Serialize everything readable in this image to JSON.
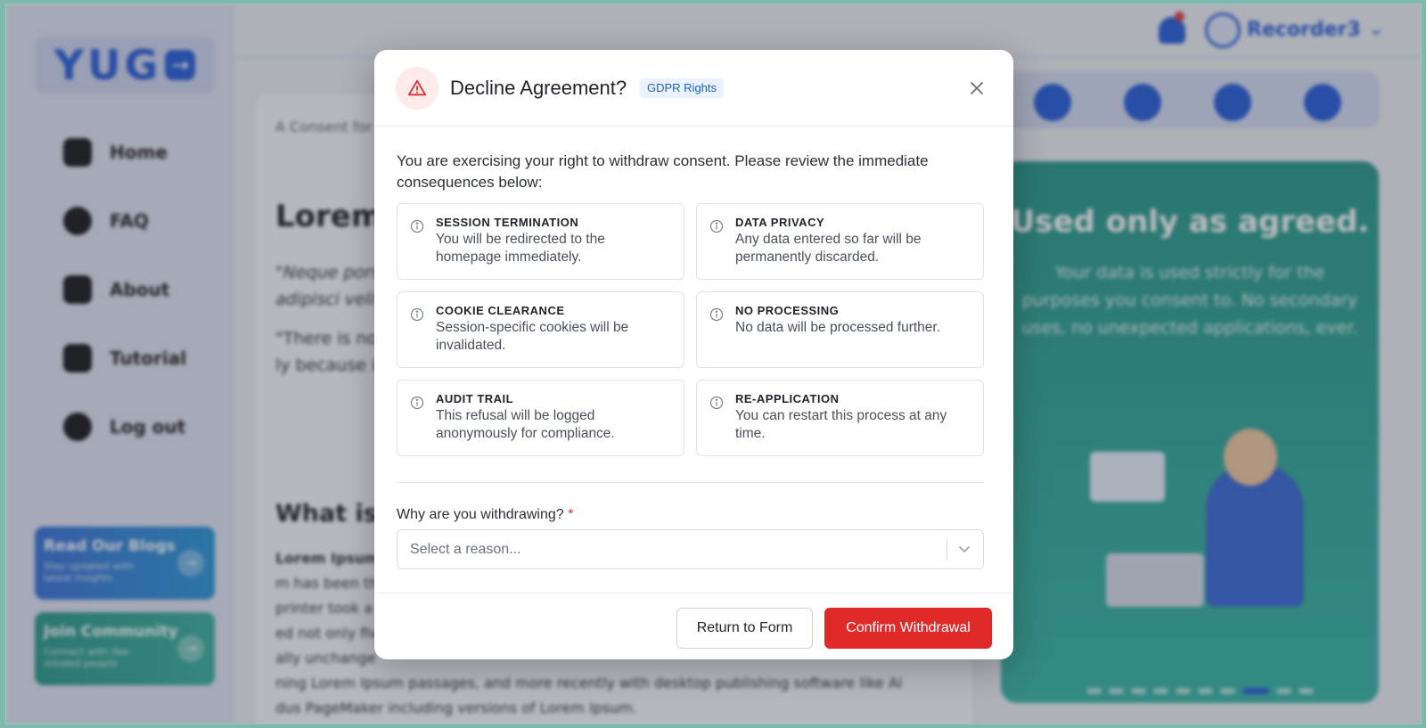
{
  "app": {
    "logo_text": "YUG",
    "username": "Recorder3"
  },
  "sidebar": {
    "items": [
      {
        "label": "Home",
        "icon": "home-icon"
      },
      {
        "label": "FAQ",
        "icon": "question-icon"
      },
      {
        "label": "About",
        "icon": "document-icon"
      },
      {
        "label": "Tutorial",
        "icon": "video-icon"
      },
      {
        "label": "Log out",
        "icon": "logout-icon"
      }
    ],
    "promos": [
      {
        "title": "Read Our Blogs",
        "subtitle": "Stay updated with latest insights"
      },
      {
        "title": "Join Community",
        "subtitle": "Connect with like-minded people"
      }
    ]
  },
  "document": {
    "breadcrumb": "A Consent for",
    "heading": "Lorem I",
    "quote_line1": "\"Neque porro",
    "quote_line2": "adipisci velit",
    "para_line1": "\"There is no o",
    "para_line2": "ly because it",
    "subheading": "What is L",
    "body_lines": [
      "Lorem Ipsum",
      "m has been th",
      "printer took a",
      "ed not only fiv",
      "ally unchange",
      "ning Lorem Ipsum passages, and more recently with desktop publishing software like Al",
      "dus PageMaker including versions of Lorem Ipsum."
    ]
  },
  "side_panel": {
    "title": "Used only as agreed.",
    "subtitle": "Your data is used strictly for the purposes you consent to. No secondary uses, no unexpected applications, ever.",
    "carousel_total": 10,
    "carousel_active": 8
  },
  "modal": {
    "title": "Decline Agreement?",
    "badge": "GDPR Rights",
    "intro": "You are exercising your right to withdraw consent. Please review the immediate consequences below:",
    "cards": [
      {
        "title": "SESSION TERMINATION",
        "desc": "You will be redirected to the homepage immediately."
      },
      {
        "title": "DATA PRIVACY",
        "desc": "Any data entered so far will be permanently discarded."
      },
      {
        "title": "COOKIE CLEARANCE",
        "desc": "Session-specific cookies will be invalidated."
      },
      {
        "title": "NO PROCESSING",
        "desc": "No data will be processed further."
      },
      {
        "title": "AUDIT TRAIL",
        "desc": "This refusal will be logged anonymously for compliance."
      },
      {
        "title": "RE-APPLICATION",
        "desc": "You can restart this process at any time."
      }
    ],
    "reason_label": "Why are you withdrawing?",
    "required_mark": "*",
    "reason_placeholder": "Select a reason...",
    "return_button": "Return to Form",
    "confirm_button": "Confirm Withdrawal"
  },
  "colors": {
    "accent": "#2a5fd8",
    "danger": "#e02a2a",
    "panel": "#2b9b8a"
  }
}
